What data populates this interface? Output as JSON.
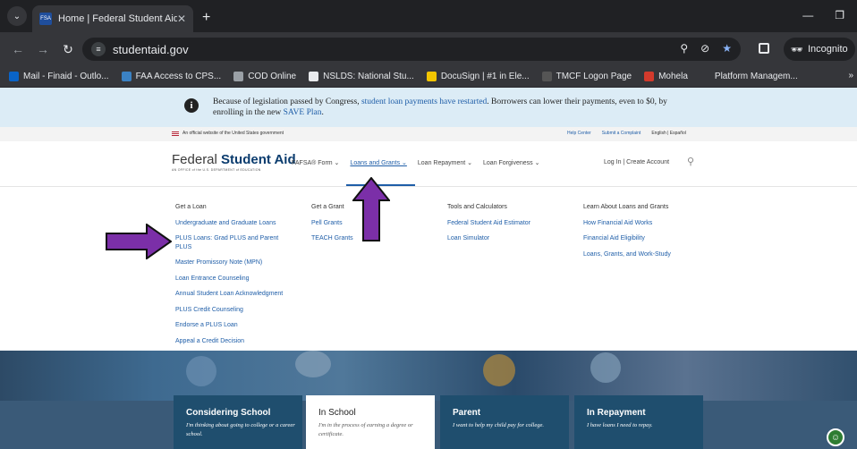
{
  "browser": {
    "tab_title": "Home | Federal Student Aid",
    "tab_favicon": "FSA",
    "url": "studentaid.gov",
    "incognito_label": "Incognito",
    "bookmarks": [
      {
        "label": "Mail - Finaid - Outlo...",
        "color": "#0a64c8"
      },
      {
        "label": "FAA Access to CPS...",
        "color": "#3b82c4"
      },
      {
        "label": "COD Online",
        "color": "#9aa0a6"
      },
      {
        "label": "NSLDS: National Stu...",
        "color": "#e8eaed"
      },
      {
        "label": "DocuSign | #1 in Ele...",
        "color": "#f2c500"
      },
      {
        "label": "TMCF Logon Page",
        "color": "#555555"
      },
      {
        "label": "Mohela",
        "color": "#d33a2c"
      },
      {
        "label": "Platform Managem...",
        "color": "#35363a"
      }
    ]
  },
  "banner": {
    "text_before": "Because of legislation passed by Congress, ",
    "link1": "student loan payments have restarted",
    "text_middle": ". Borrowers can lower their payments, even to $0, by enrolling in the new ",
    "link2": "SAVE Plan",
    "text_after": "."
  },
  "gov_strip": {
    "official": "An official website of the United States government",
    "help_center": "Help Center",
    "complaint": "Submit a Complaint",
    "language": "English | Español"
  },
  "header": {
    "logo_plain": "Federal ",
    "logo_bold": "Student Aid",
    "logo_sub": "AN OFFICE of the U.S. DEPARTMENT of EDUCATION",
    "nav": [
      "FAFSA® Form ⌄",
      "Loans and Grants ⌄",
      "Loan Repayment ⌄",
      "Loan Forgiveness ⌄"
    ],
    "account": "Log In  |  Create Account"
  },
  "menu": {
    "get_loan": {
      "heading": "Get a Loan",
      "items": [
        "Undergraduate and Graduate Loans",
        "PLUS Loans: Grad PLUS and Parent PLUS",
        "Master Promissory Note (MPN)",
        "Loan Entrance Counseling",
        "Annual Student Loan Acknowledgment",
        "PLUS Credit Counseling",
        "Endorse a PLUS Loan",
        "Appeal a Credit Decision"
      ]
    },
    "get_grant": {
      "heading": "Get a Grant",
      "items": [
        "Pell Grants",
        "TEACH Grants"
      ]
    },
    "tools": {
      "heading": "Tools and Calculators",
      "items": [
        "Federal Student Aid Estimator",
        "Loan Simulator"
      ]
    },
    "learn": {
      "heading": "Learn About Loans and Grants",
      "items": [
        "How Financial Aid Works",
        "Financial Aid Eligibility",
        "Loans, Grants, and Work-Study"
      ]
    }
  },
  "cards": [
    {
      "title": "Considering School",
      "subtitle": "I'm thinking about going to college or a career school."
    },
    {
      "title": "In School",
      "subtitle": "I'm in the process of earning a degree or certificate."
    },
    {
      "title": "Parent",
      "subtitle": "I want to help my child pay for college."
    },
    {
      "title": "In Repayment",
      "subtitle": "I have loans I need to repay."
    }
  ],
  "colors": {
    "annotation_arrow": "#7b2fa8",
    "link_blue": "#1f5ea8",
    "banner_bg": "#dcecf6",
    "card_dark": "#1f4e6e"
  },
  "icons": {
    "info": "info-circle-icon",
    "search": "search-icon",
    "chat": "chatbot-icon"
  }
}
